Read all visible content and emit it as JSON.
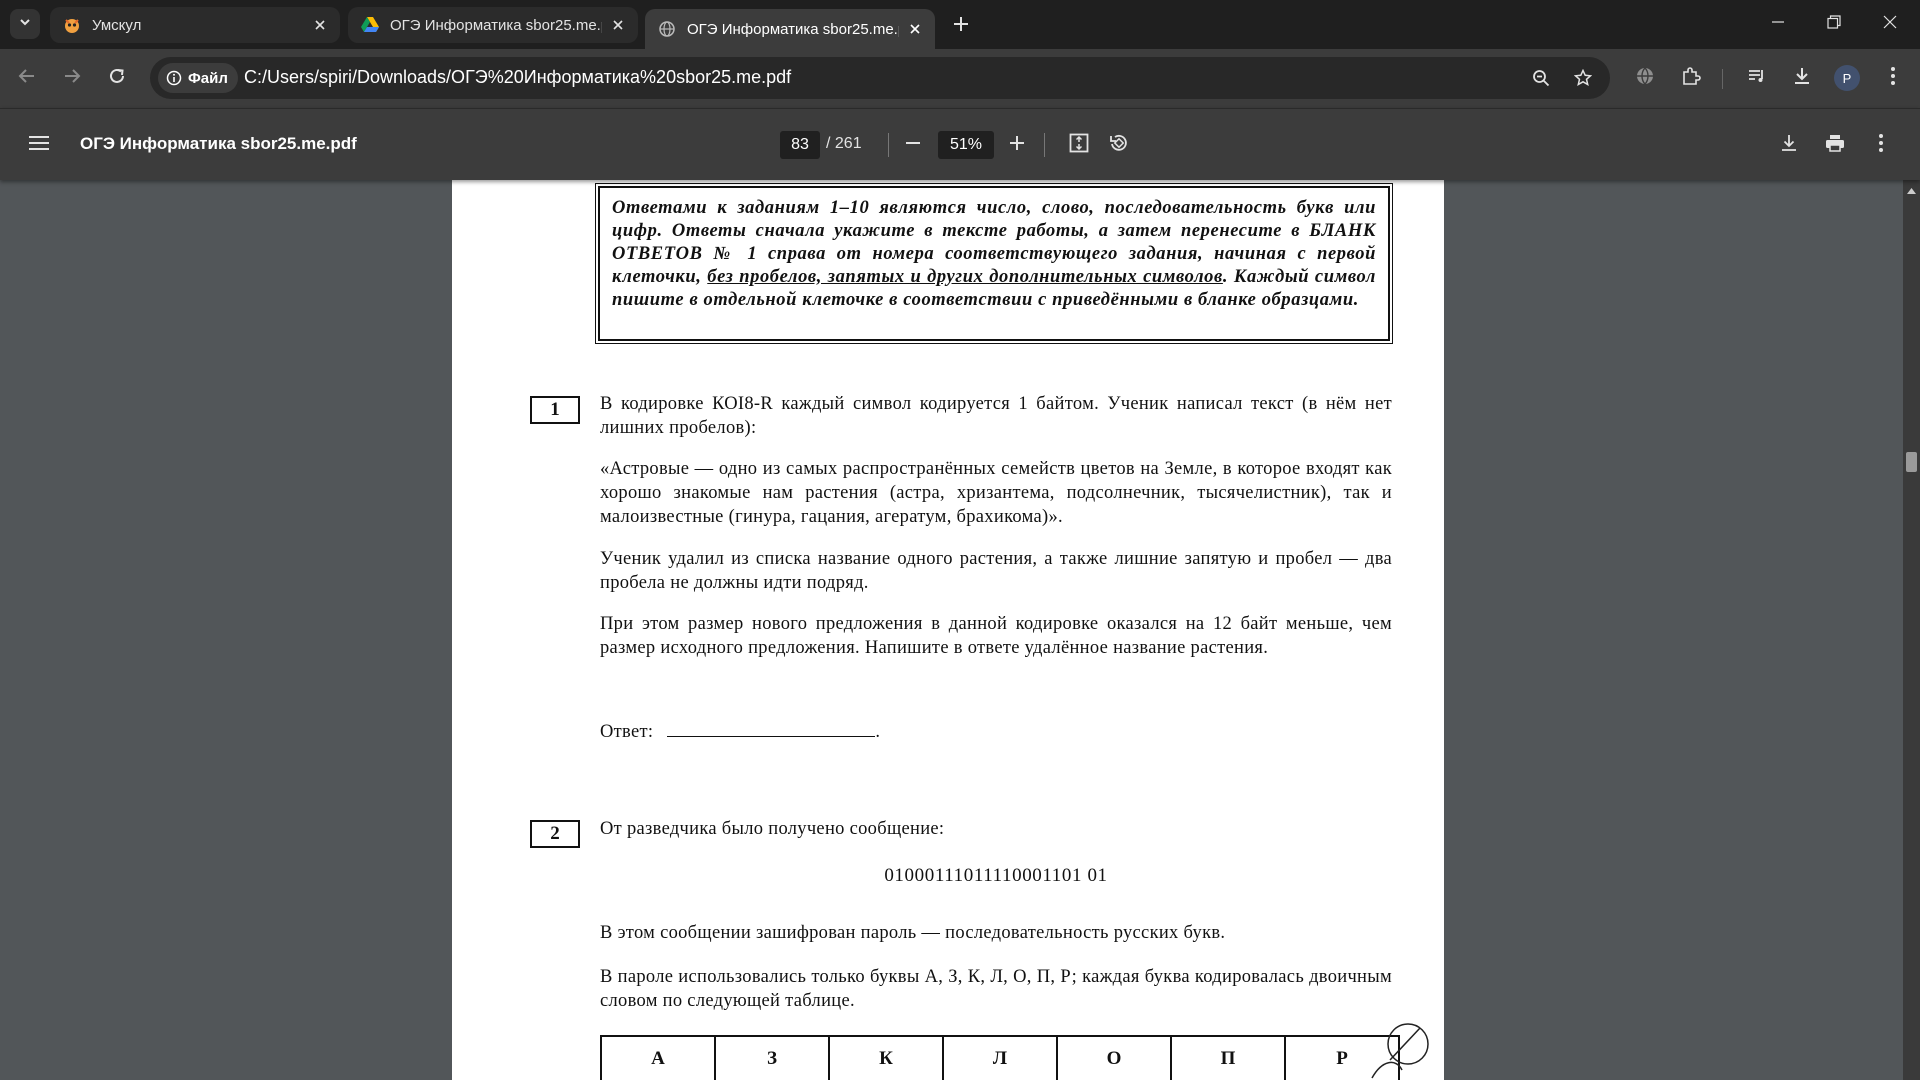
{
  "tabs": [
    {
      "title": "Умскул",
      "favicon": "umskul-favicon",
      "state": "inactive"
    },
    {
      "title": "ОГЭ Информатика sbor25.me.pdf",
      "favicon": "google-drive-icon",
      "state": "inactive"
    },
    {
      "title": "ОГЭ Информатика sbor25.me.pdf",
      "favicon": "globe-icon",
      "state": "active"
    }
  ],
  "address": {
    "chip_label": "Файл",
    "url": "C:/Users/spiri/Downloads/ОГЭ%20Информатика%20sbor25.me.pdf"
  },
  "profile_initial": "P",
  "pdf": {
    "title": "ОГЭ Информатика sbor25.me.pdf",
    "page_current": "83",
    "page_total": "/ 261",
    "zoom": "51%"
  },
  "document": {
    "instructions_before_underline": "Ответами к заданиям 1–10 являются число, слово, последовательность букв или цифр. Ответы сначала укажите в тексте работы, а затем перенесите в БЛАНК ОТВЕТОВ № 1 справа от номера соответствующего задания, начиная с первой клеточки, ",
    "instructions_underline": "без пробелов, запятых и других дополнительных символов",
    "instructions_after_underline": ". Каждый символ пишите в отдельной клеточке в соответствии с приведёнными в бланке образцами.",
    "q1": {
      "number": "1",
      "p1": "В кодировке КОI8-R каждый символ кодируется 1 байтом. Ученик написал текст (в нём нет лишних пробелов):",
      "p2": "«Астровые — одно из самых распространённых семейств цветов на Земле, в которое входят как хорошо знакомые нам растения (астра, хризантема, подсолнечник, тысячелистник), так и малоизвестные (гинура, гацания, агератум, брахикома)».",
      "p3": "Ученик удалил из списка название одного растения, а также лишние запятую и пробел — два пробела не должны идти подряд.",
      "p4": "При этом размер нового предложения в данной кодировке оказался на 12 байт меньше, чем размер исходного предложения. Напишите в ответе удалённое название растения.",
      "answer_label": "Ответ:"
    },
    "q2": {
      "number": "2",
      "p1": "От разведчика было получено сообщение:",
      "code": "01000111011110001101 01",
      "p2": "В этом сообщении зашифрован пароль — последовательность русских букв.",
      "p3": "В пароле использовались только буквы А, З, К, Л, О, П, Р; каждая буква кодировалась двоичным словом по следующей таблице.",
      "letters": [
        "А",
        "З",
        "К",
        "Л",
        "О",
        "П",
        "Р"
      ]
    }
  }
}
